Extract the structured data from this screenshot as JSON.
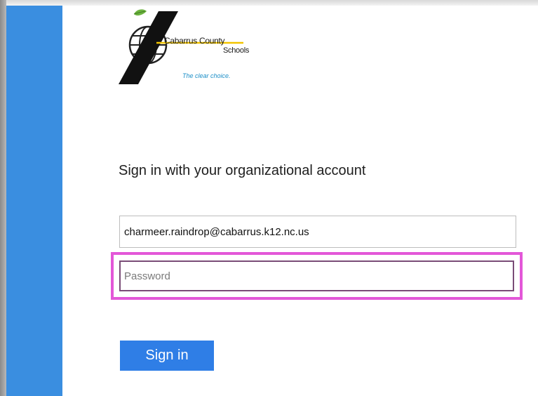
{
  "logo": {
    "line1": "Cabarrus County",
    "line2": "Schools",
    "tagline": "The clear choice."
  },
  "signin": {
    "heading": "Sign in with your organizational account",
    "email_value": "charmeer.raindrop@cabarrus.k12.nc.us",
    "password_placeholder": "Password",
    "button_label": "Sign in"
  },
  "colors": {
    "side_panel": "#3a8ee0",
    "button": "#2f7ee6",
    "highlight": "#e357d8",
    "tagline": "#1b8ec7"
  }
}
